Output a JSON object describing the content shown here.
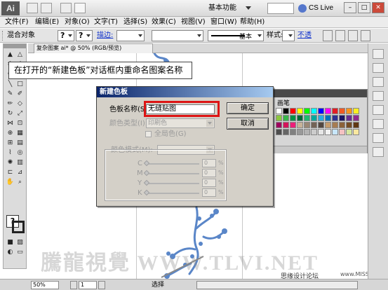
{
  "app": {
    "logo_text": "Ai",
    "workspace_label": "基本功能",
    "cslive_label": "CS Live"
  },
  "menu": {
    "items": [
      "文件(F)",
      "编辑(E)",
      "对象(O)",
      "文字(T)",
      "选择(S)",
      "效果(C)",
      "视图(V)",
      "窗口(W)",
      "帮助(H)"
    ]
  },
  "controlbar": {
    "mixed_objects_label": "混合对象",
    "stroke_link": "描边:",
    "stroke_style_label": "基本",
    "style_label": "样式:",
    "opacity_link": "不透"
  },
  "document_tab": {
    "title": "复杂图案 ai* @ 50% (RGB/预览)"
  },
  "callout": {
    "text": "在打开的“新建色板”对话框内重命名图案名称"
  },
  "dialog": {
    "title": "新建色板",
    "name_label": "色板名称(S):",
    "name_value": "无缝贴图",
    "color_type_label": "颜色类型(I):",
    "color_type_value": "印刷色",
    "global_label": "全局色(G)",
    "color_mode_label": "颜色模式(M):",
    "channels": [
      "C",
      "M",
      "Y",
      "K"
    ],
    "channel_values": [
      "0",
      "0",
      "0",
      "0"
    ],
    "percent_sign": "%",
    "ok_label": "确定",
    "cancel_label": "取消"
  },
  "swatches_panel": {
    "tab_label": "画笔",
    "colors": [
      "#ffffff",
      "#000000",
      "#ff0000",
      "#ffff00",
      "#00ff00",
      "#00ffff",
      "#0000ff",
      "#ff00ff",
      "#e31d23",
      "#ef5a24",
      "#f7931e",
      "#fcee21",
      "#8cc63e",
      "#39b54a",
      "#009245",
      "#006837",
      "#22b573",
      "#00a99d",
      "#29abe2",
      "#0071bc",
      "#2e3192",
      "#1b1464",
      "#662d91",
      "#93278f",
      "#9e005d",
      "#d4145a",
      "#ed1e79",
      "#c7b299",
      "#998675",
      "#736357",
      "#534741",
      "#c69c6d",
      "#a67c52",
      "#8c6239",
      "#754c24",
      "#603813",
      "#4d4d4d",
      "#666666",
      "#808080",
      "#999999",
      "#b3b3b3",
      "#cccccc",
      "#e6e6e6",
      "#f2f2f2",
      "#c8e6fa",
      "#f4c2c2",
      "#d4e79e",
      "#f9e79f"
    ]
  },
  "statusbar": {
    "zoom_value": "50%",
    "page_value": "1",
    "tool_label": "选择"
  },
  "watermark": {
    "big_text": "騰龍視覺 WWW.TLVI.NET",
    "small_text": "思缘设计论坛",
    "small_url": "www.MISSYUAN.COM"
  }
}
